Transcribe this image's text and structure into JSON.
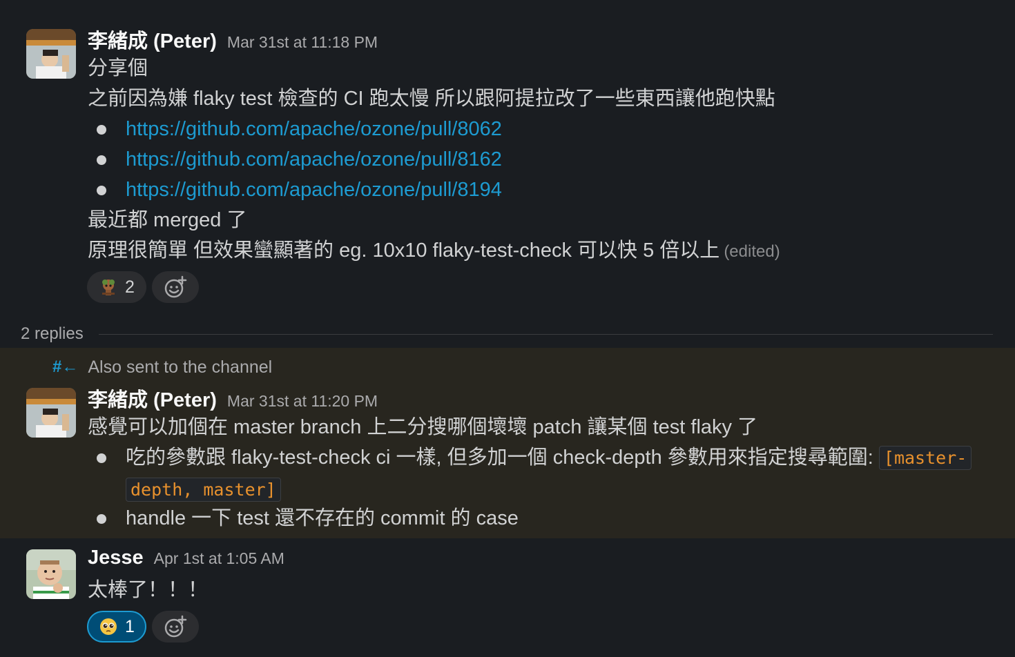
{
  "messages": [
    {
      "author": "李緒成 (Peter)",
      "timestamp": "Mar 31st at 11:18 PM",
      "lines": [
        "分享個",
        "之前因為嫌 flaky test 檢查的 CI 跑太慢 所以跟阿提拉改了一些東西讓他跑快點"
      ],
      "links": [
        "https://github.com/apache/ozone/pull/8062",
        "https://github.com/apache/ozone/pull/8162",
        "https://github.com/apache/ozone/pull/8194"
      ],
      "after_lines": [
        "最近都 merged 了",
        "原理很簡單 但效果蠻顯著的 eg. 10x10 flaky-test-check 可以快 5 倍以上"
      ],
      "edited_label": "(edited)",
      "reactions": [
        {
          "emoji": "tree-creature-emoji",
          "count": "2",
          "active": false
        }
      ]
    },
    {
      "author": "李緒成 (Peter)",
      "timestamp": "Mar 31st at 11:20 PM",
      "also_sent_label": "Also sent to the channel",
      "lines": [
        "感覺可以加個在 master branch 上二分搜哪個壞壞 patch 讓某個 test flaky 了"
      ],
      "bullets": [
        {
          "text": "吃的參數跟 flaky-test-check ci 一樣, 但多加一個 check-depth 參數用來指定搜尋範圍:",
          "code_part1": "[master-",
          "code_part2": "depth, master]"
        },
        {
          "text": "handle 一下 test 還不存在的 commit 的 case"
        }
      ]
    },
    {
      "author": "Jesse",
      "timestamp": "Apr 1st at 1:05 AM",
      "lines": [
        "太棒了！！！"
      ],
      "reactions": [
        {
          "emoji": "pleading-face-emoji",
          "count": "1",
          "active": true
        }
      ]
    }
  ],
  "thread": {
    "replies_label": "2 replies"
  },
  "colors": {
    "background": "#1a1d21",
    "link": "#1d9bd1",
    "highlight": "#28261f",
    "code": "#e8912d"
  }
}
